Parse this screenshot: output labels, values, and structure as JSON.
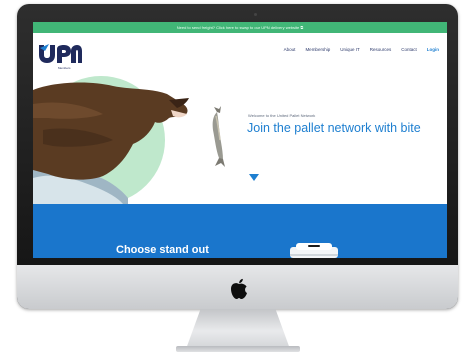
{
  "promo": {
    "text": "Need to send freight? Click here to swap to our UPN delivery website ⧉"
  },
  "brand": {
    "logo_text": "upn",
    "logo_subtext": "Members"
  },
  "nav": {
    "items": [
      "About",
      "Membership",
      "Unique IT",
      "Resources",
      "Contact"
    ],
    "login": "Login"
  },
  "hero": {
    "kicker": "Welcome to the United Pallet Network",
    "title": "Join the pallet network with bite"
  },
  "band": {
    "heading": "Choose stand out"
  },
  "colors": {
    "promo_green": "#41b677",
    "brand_blue": "#1e7fd0",
    "band_blue": "#1a76cc",
    "circle_mint": "#bfe8cc",
    "navy": "#1f2a5c"
  },
  "icons": {
    "hero_arrow": "chevron-down-icon",
    "device_logo": "apple-icon"
  }
}
